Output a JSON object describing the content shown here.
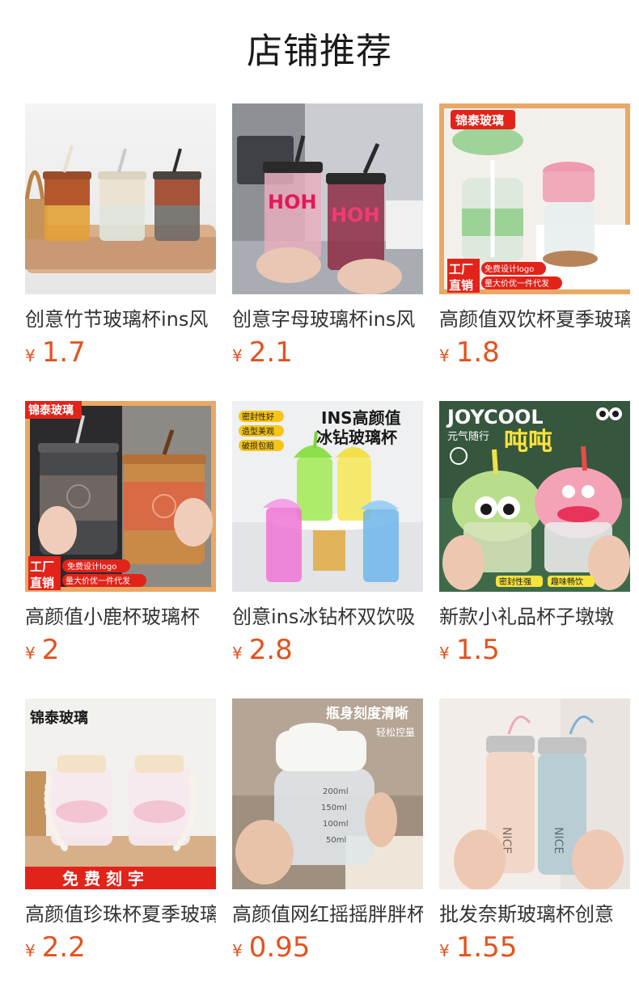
{
  "page": {
    "title": "店铺推荐"
  },
  "products": [
    {
      "name": "创意竹节玻璃杯ins风",
      "currency": "¥",
      "price": "1.7",
      "image": "three-glass-cups-leather-sleeves",
      "badges": []
    },
    {
      "name": "创意字母玻璃杯ins风",
      "currency": "¥",
      "price": "2.1",
      "image": "pink-letter-glass-cups",
      "badges": []
    },
    {
      "name": "高颜值双饮杯夏季玻璃",
      "currency": "¥",
      "price": "1.8",
      "image": "green-pink-lid-glass-jars",
      "badges": [
        "锦泰玻璃",
        "工厂",
        "直销",
        "免费设计logo",
        "量大价优一件代发"
      ]
    },
    {
      "name": "高颜值小鹿杯玻璃杯",
      "currency": "¥",
      "price": "2",
      "image": "deer-cup-leather-sleeve",
      "badges": [
        "锦泰玻璃",
        "工厂",
        "直销",
        "免费设计logo",
        "量大价优一件代发"
      ]
    },
    {
      "name": "创意ins冰钻杯双饮吸",
      "currency": "¥",
      "price": "2.8",
      "image": "ice-diamond-straw-cups",
      "badges": [
        "INS高颜值",
        "冰钻玻璃杯",
        "密封性好",
        "造型美观",
        "破损包赔"
      ]
    },
    {
      "name": "新款小礼品杯子墩墩",
      "currency": "¥",
      "price": "1.5",
      "image": "cartoon-face-cups",
      "badges": [
        "JOYCOOL",
        "元气随行",
        "吨吨",
        "密封性强",
        "趣味畅饮"
      ]
    },
    {
      "name": "高颜值珍珠杯夏季玻璃",
      "currency": "¥",
      "price": "2.2",
      "image": "pearl-strap-glass-cups",
      "badges": [
        "锦泰玻璃",
        "免 费 刻 字"
      ]
    },
    {
      "name": "高颜值网红摇摇胖胖杯",
      "currency": "¥",
      "price": "0.95",
      "image": "graduated-glass-jar",
      "badges": [
        "瓶身刻度清晰",
        "轻松控量"
      ]
    },
    {
      "name": "批发奈斯玻璃杯创意",
      "currency": "¥",
      "price": "1.55",
      "image": "nice-thermos-bottles",
      "badges": []
    }
  ],
  "colors": {
    "price": "#e4521d",
    "title": "#1a1a1a",
    "text": "#333333"
  }
}
